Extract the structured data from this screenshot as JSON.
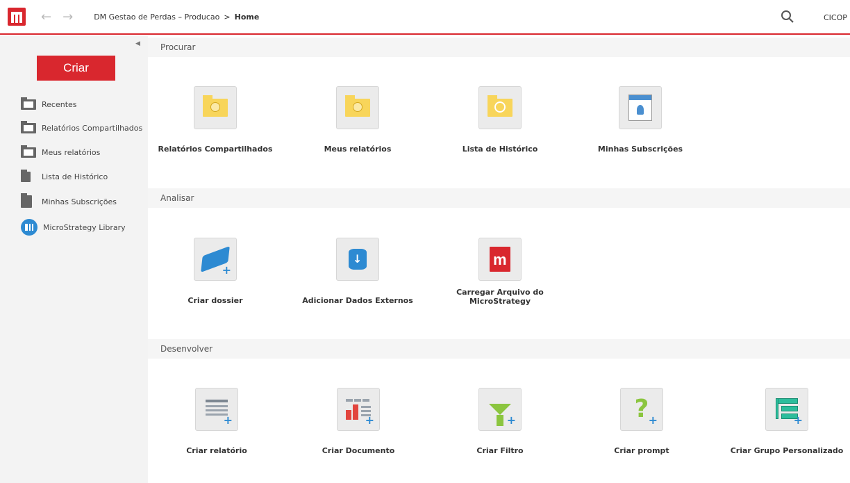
{
  "header": {
    "breadcrumb_app": "DM Gestao de Perdas – Producao",
    "breadcrumb_sep": ">",
    "breadcrumb_current": "Home",
    "user": "CICOP"
  },
  "sidebar": {
    "create_label": "Criar",
    "items": [
      {
        "label": "Recentes",
        "icon": "clock-folder-icon"
      },
      {
        "label": "Relatórios Compartilhados",
        "icon": "shared-folder-icon"
      },
      {
        "label": "Meus relatórios",
        "icon": "user-folder-icon"
      },
      {
        "label": "Lista de Histórico",
        "icon": "history-list-icon"
      },
      {
        "label": "Minhas Subscrições",
        "icon": "bookmark-icon"
      },
      {
        "label": "MicroStrategy Library",
        "icon": "library-icon"
      }
    ]
  },
  "sections": {
    "procurar": {
      "title": "Procurar",
      "tiles": [
        {
          "label": "Relatórios Compartilhados",
          "icon": "shared-folder-icon"
        },
        {
          "label": "Meus relatórios",
          "icon": "user-folder-icon"
        },
        {
          "label": "Lista de Histórico",
          "icon": "history-folder-icon"
        },
        {
          "label": "Minhas Subscrições",
          "icon": "subscription-icon"
        }
      ]
    },
    "analisar": {
      "title": "Analisar",
      "tiles": [
        {
          "label": "Criar dossier",
          "icon": "dossier-icon"
        },
        {
          "label": "Adicionar Dados Externos",
          "icon": "database-icon"
        },
        {
          "label": "Carregar Arquivo do MicroStrategy",
          "icon": "microstrategy-file-icon"
        }
      ]
    },
    "desenvolver": {
      "title": "Desenvolver",
      "tiles": [
        {
          "label": "Criar relatório",
          "icon": "report-grid-icon"
        },
        {
          "label": "Criar Documento",
          "icon": "document-icon"
        },
        {
          "label": "Criar Filtro",
          "icon": "filter-icon"
        },
        {
          "label": "Criar prompt",
          "icon": "prompt-icon"
        },
        {
          "label": "Criar Grupo Personalizado",
          "icon": "custom-group-icon"
        }
      ]
    }
  },
  "colors": {
    "accent": "#d9272e",
    "blue": "#2d8ad2",
    "green": "#8bc53f",
    "folder": "#f8d55a"
  }
}
